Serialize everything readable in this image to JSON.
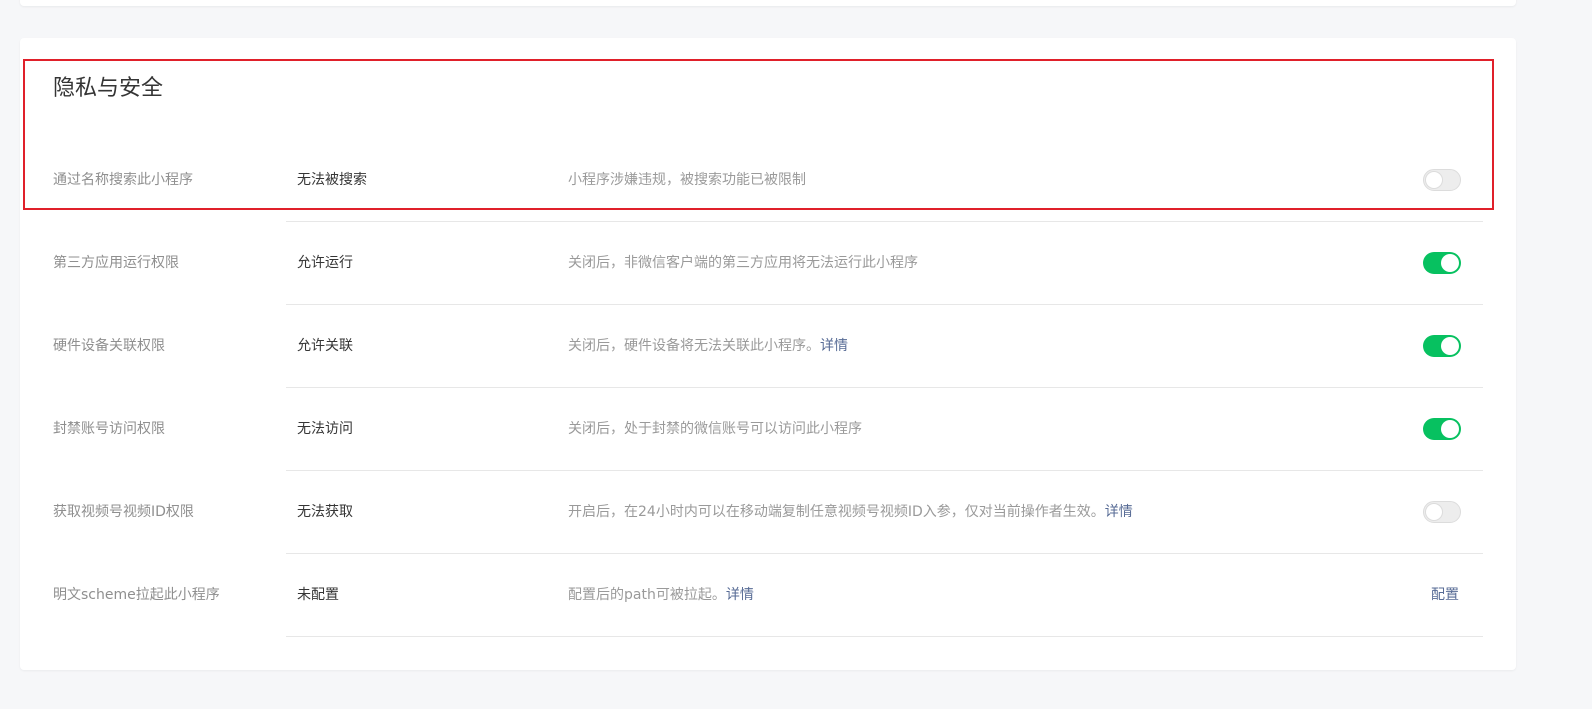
{
  "section": {
    "title": "隐私与安全"
  },
  "rows": [
    {
      "label": "通过名称搜索此小程序",
      "value": "无法被搜索",
      "desc": "小程序涉嫌违规，被搜索功能已被限制",
      "desc_link": "",
      "control": "toggle",
      "toggle_on": false
    },
    {
      "label": "第三方应用运行权限",
      "value": "允许运行",
      "desc": "关闭后，非微信客户端的第三方应用将无法运行此小程序",
      "desc_link": "",
      "control": "toggle",
      "toggle_on": true
    },
    {
      "label": "硬件设备关联权限",
      "value": "允许关联",
      "desc": "关闭后，硬件设备将无法关联此小程序。",
      "desc_link": "详情",
      "control": "toggle",
      "toggle_on": true
    },
    {
      "label": "封禁账号访问权限",
      "value": "无法访问",
      "desc": "关闭后，处于封禁的微信账号可以访问此小程序",
      "desc_link": "",
      "control": "toggle",
      "toggle_on": true
    },
    {
      "label": "获取视频号视频ID权限",
      "value": "无法获取",
      "desc": "开启后，在24小时内可以在移动端复制任意视频号视频ID入参，仅对当前操作者生效。",
      "desc_link": "详情",
      "control": "toggle",
      "toggle_on": false
    },
    {
      "label": "明文scheme拉起此小程序",
      "value": "未配置",
      "desc": "配置后的path可被拉起。",
      "desc_link": "详情",
      "control": "link",
      "control_label": "配置"
    }
  ],
  "colors": {
    "toggle_on": "#07c160",
    "link": "#576b95",
    "highlight_border": "#e0202a"
  }
}
